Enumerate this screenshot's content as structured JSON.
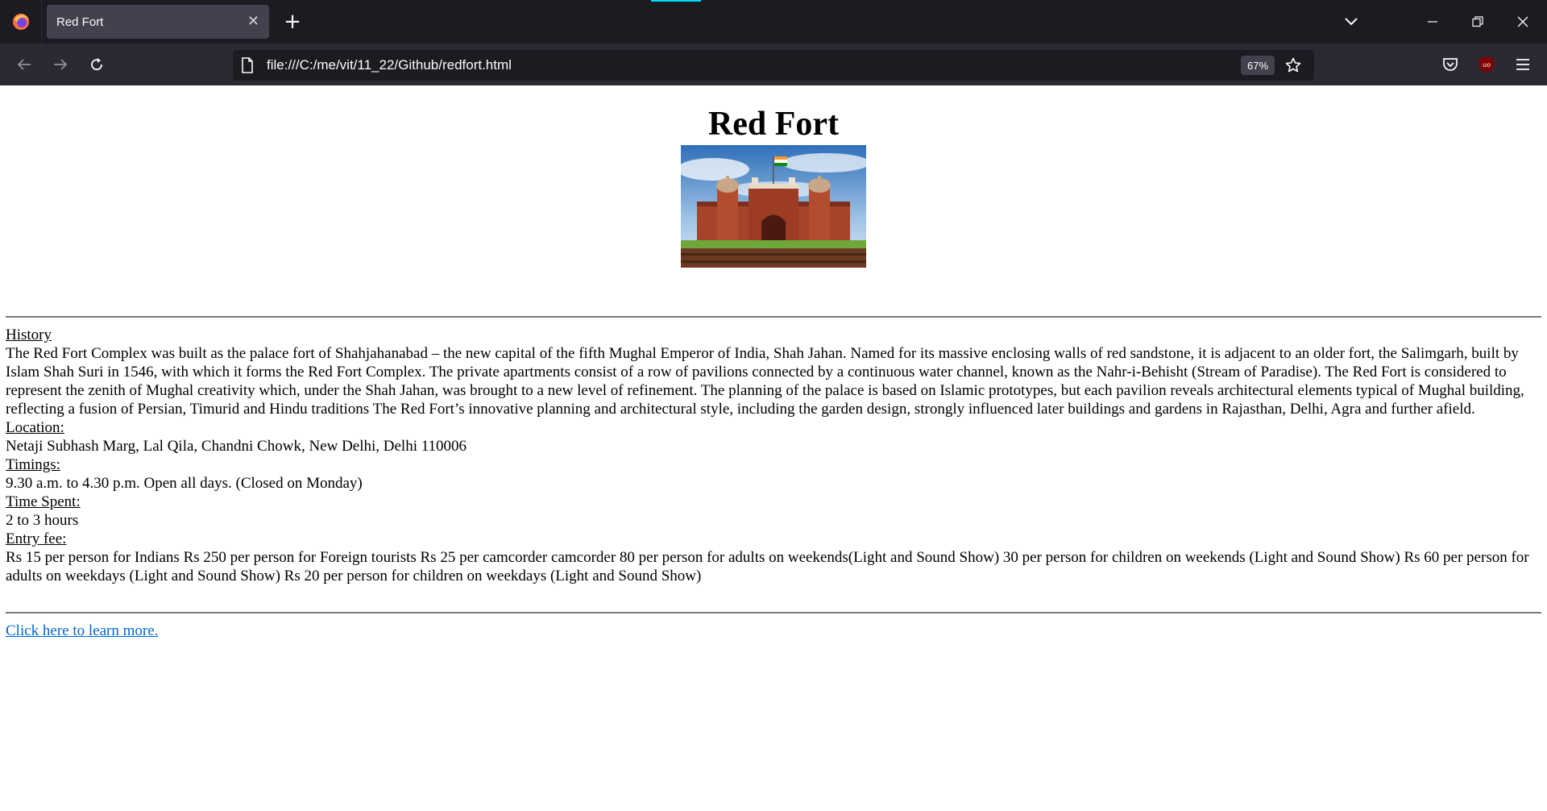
{
  "browser": {
    "tab_title": "Red Fort",
    "tab_close": "✕",
    "new_tab": "+",
    "url": "file:///C:/me/vit/11_22/Github/redfort.html",
    "zoom": "67%",
    "colors": {
      "chrome_dark": "#1c1b22",
      "toolbar": "#2b2a33",
      "tab_active": "#42414d",
      "accent": "#00ddff"
    }
  },
  "page": {
    "title": "Red Fort",
    "image_alt_subject": "Red Fort gate with Indian flag",
    "sections": [
      {
        "heading": "History",
        "text": "The Red Fort Complex was built as the palace fort of Shahjahanabad – the new capital of the fifth Mughal Emperor of India, Shah Jahan. Named for its massive enclosing walls of red sandstone, it is adjacent to an older fort, the Salimgarh, built by Islam Shah Suri in 1546, with which it forms the Red Fort Complex. The private apartments consist of a row of pavilions connected by a continuous water channel, known as the Nahr-i-Behisht (Stream of Paradise). The Red Fort is considered to represent the zenith of Mughal creativity which, under the Shah Jahan, was brought to a new level of refinement. The planning of the palace is based on Islamic prototypes, but each pavilion reveals architectural elements typical of Mughal building, reflecting a fusion of Persian, Timurid and Hindu traditions The Red Fort’s innovative planning and architectural style, including the garden design, strongly influenced later buildings and gardens in Rajasthan, Delhi, Agra and further afield."
      },
      {
        "heading": "Location:",
        "text": "Netaji Subhash Marg, Lal Qila, Chandni Chowk, New Delhi, Delhi 110006"
      },
      {
        "heading": "Timings:",
        "text": "9.30 a.m. to 4.30 p.m. Open all days. (Closed on Monday)"
      },
      {
        "heading": "Time Spent:",
        "text": "2 to 3 hours"
      },
      {
        "heading": "Entry fee:",
        "text": "Rs 15 per person for Indians Rs 250 per person for Foreign tourists Rs 25 per camcorder camcorder 80 per person for adults on weekends(Light and Sound Show) 30 per person for children on weekends (Light and Sound Show) Rs 60 per person for adults on weekdays (Light and Sound Show) Rs 20 per person for children on weekdays (Light and Sound Show)"
      }
    ],
    "link_text": "Click here to learn more.",
    "link_color": "#0066cc"
  }
}
